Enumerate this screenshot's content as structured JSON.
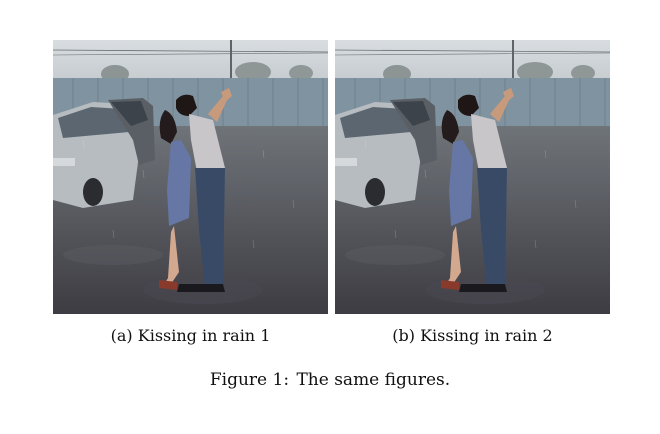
{
  "figure": {
    "label": "Figure 1:",
    "caption": "The same figures.",
    "subfigures": [
      {
        "label": "(a)",
        "caption": "Kissing in rain 1"
      },
      {
        "label": "(b)",
        "caption": "Kissing in rain 2"
      }
    ]
  }
}
